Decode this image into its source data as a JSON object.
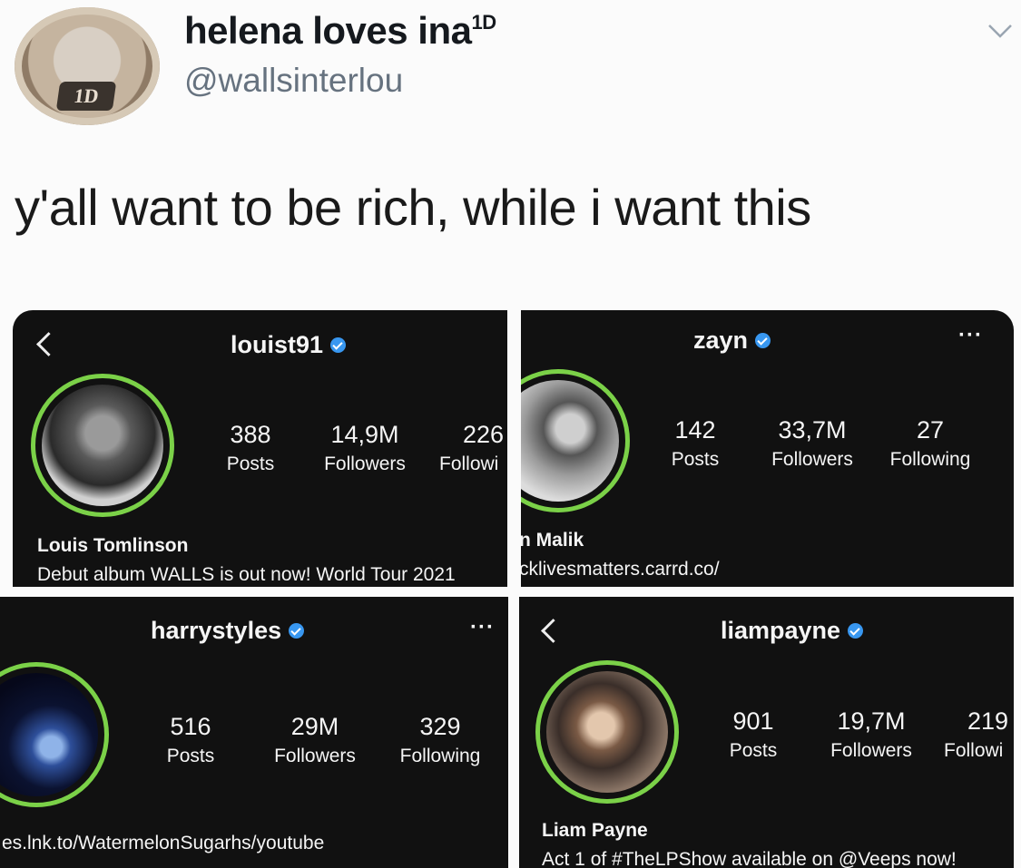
{
  "tweet": {
    "display_name": "helena loves ina",
    "name_suffix": "1D",
    "handle": "@wallsinterlou",
    "text": "y'all want to be rich, while i want this",
    "avatar_text": "1D",
    "menu_icon": "chevron-down-icon"
  },
  "profiles": [
    {
      "username": "louist91",
      "stats": [
        {
          "num": "388",
          "label": "Posts"
        },
        {
          "num": "14,9M",
          "label": "Followers"
        },
        {
          "num": "226",
          "label": "Followi"
        }
      ],
      "name": "Louis Tomlinson",
      "bio": "Debut album WALLS is out now! World Tour 2021"
    },
    {
      "username": "zayn",
      "stats": [
        {
          "num": "142",
          "label": "Posts"
        },
        {
          "num": "33,7M",
          "label": "Followers"
        },
        {
          "num": "27",
          "label": "Following"
        }
      ],
      "name": "n Malik",
      "bio": "cklivesmatters.carrd.co/"
    },
    {
      "username": "harrystyles",
      "stats": [
        {
          "num": "516",
          "label": "Posts"
        },
        {
          "num": "29M",
          "label": "Followers"
        },
        {
          "num": "329",
          "label": "Following"
        }
      ],
      "bio": "es.lnk.to/WatermelonSugarhs/youtube"
    },
    {
      "username": "liampayne",
      "stats": [
        {
          "num": "901",
          "label": "Posts"
        },
        {
          "num": "19,7M",
          "label": "Followers"
        },
        {
          "num": "219",
          "label": "Followi"
        }
      ],
      "name": "Liam Payne",
      "bio": "Act 1 of #TheLPShow available on @Veeps now!"
    }
  ],
  "colors": {
    "story_ring": "#7bd148",
    "verified": "#3897f0",
    "card_bg": "#111111"
  }
}
